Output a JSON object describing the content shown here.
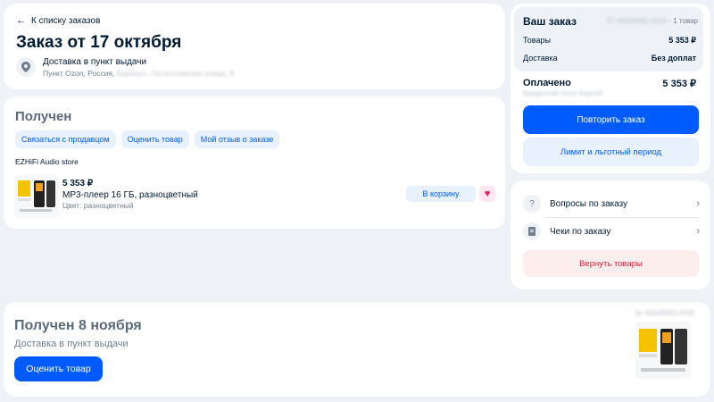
{
  "header": {
    "back_label": "К списку заказов",
    "title": "Заказ от 17 октября",
    "delivery_type": "Доставка в пункт выдачи",
    "address_prefix": "Пункт Ozon, Россия,",
    "address_hidden": "Барнаул, Гастелловская улица, 9"
  },
  "order": {
    "status": "Получен",
    "actions": [
      "Связаться с продавцом",
      "Оценить товар",
      "Мой отзыв о заказе"
    ],
    "store": "EZHiFi Audio store",
    "item": {
      "price": "5 353 ₽",
      "name": "MP3-плеер 16 ГБ, разноцветный",
      "color": "Цвет: разноцветный",
      "cart_label": "В корзину",
      "image": "mp3-player-product-image"
    }
  },
  "summary": {
    "title": "Ваш заказ",
    "order_id": "97-46048385-0020",
    "items_count": "· 1 товар",
    "goods_label": "Товары",
    "goods_value": "5 353 ₽",
    "delivery_label": "Доставка",
    "delivery_value": "Без доплат",
    "paid_label": "Оплачено",
    "paid_value": "5 353 ₽",
    "paid_method": "Кредитной Ozon Картой",
    "repeat_label": "Повторить заказ",
    "limit_label": "Лимит и льготный период"
  },
  "help": {
    "questions_label": "Вопросы по заказу",
    "receipts_label": "Чеки по заказу",
    "return_label": "Вернуть товары"
  },
  "bottom": {
    "title": "Получен 8 ноября",
    "subtitle": "Доставка в пункт выдачи",
    "rate_label": "Оценить товар",
    "order_id": "№ 46048993-0039"
  },
  "colors": {
    "accent": "#005bff",
    "accent_light": "#e8f2ff",
    "danger": "#e5213a",
    "background": "#eef1f5"
  }
}
